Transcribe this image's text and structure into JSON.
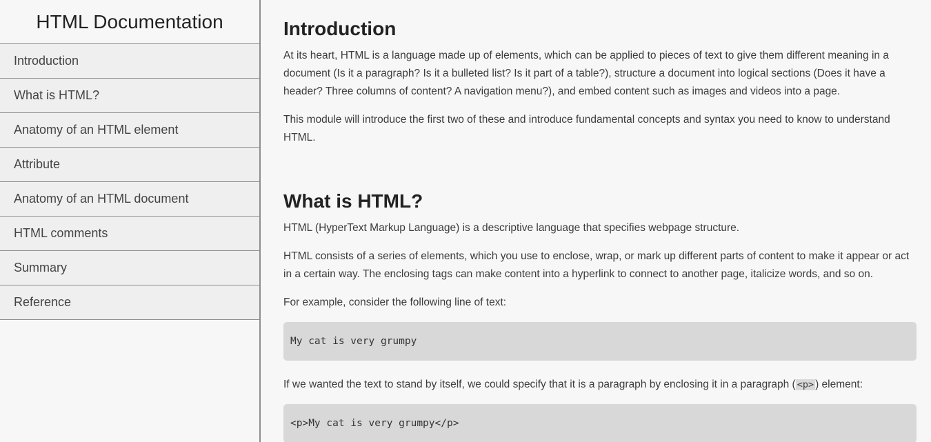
{
  "sidebar": {
    "title": "HTML Documentation",
    "items": [
      {
        "label": "Introduction"
      },
      {
        "label": "What is HTML?"
      },
      {
        "label": "Anatomy of an HTML element"
      },
      {
        "label": "Attribute"
      },
      {
        "label": "Anatomy of an HTML document"
      },
      {
        "label": "HTML comments"
      },
      {
        "label": "Summary"
      },
      {
        "label": "Reference"
      }
    ]
  },
  "main": {
    "sections": [
      {
        "title": "Introduction",
        "paragraphs": [
          "At its heart, HTML is a language made up of elements, which can be applied to pieces of text to give them different meaning in a document (Is it a paragraph? Is it a bulleted list? Is it part of a table?), structure a document into logical sections (Does it have a header? Three columns of content? A navigation menu?), and embed content such as images and videos into a page.",
          "This module will introduce the first two of these and introduce fundamental concepts and syntax you need to know to understand HTML."
        ]
      },
      {
        "title": "What is HTML?",
        "p1": "HTML (HyperText Markup Language) is a descriptive language that specifies webpage structure.",
        "p2": "HTML consists of a series of elements, which you use to enclose, wrap, or mark up different parts of content to make it appear or act in a certain way. The enclosing tags can make content into a hyperlink to connect to another page, italicize words, and so on.",
        "p3": "For example, consider the following line of text:",
        "code1": "My cat is very grumpy",
        "p4_before": "If we wanted the text to stand by itself, we could specify that it is a paragraph by enclosing it in a paragraph (",
        "p4_code": "<p>",
        "p4_after": ") element:",
        "code2": "<p>My cat is very grumpy</p>"
      }
    ]
  }
}
